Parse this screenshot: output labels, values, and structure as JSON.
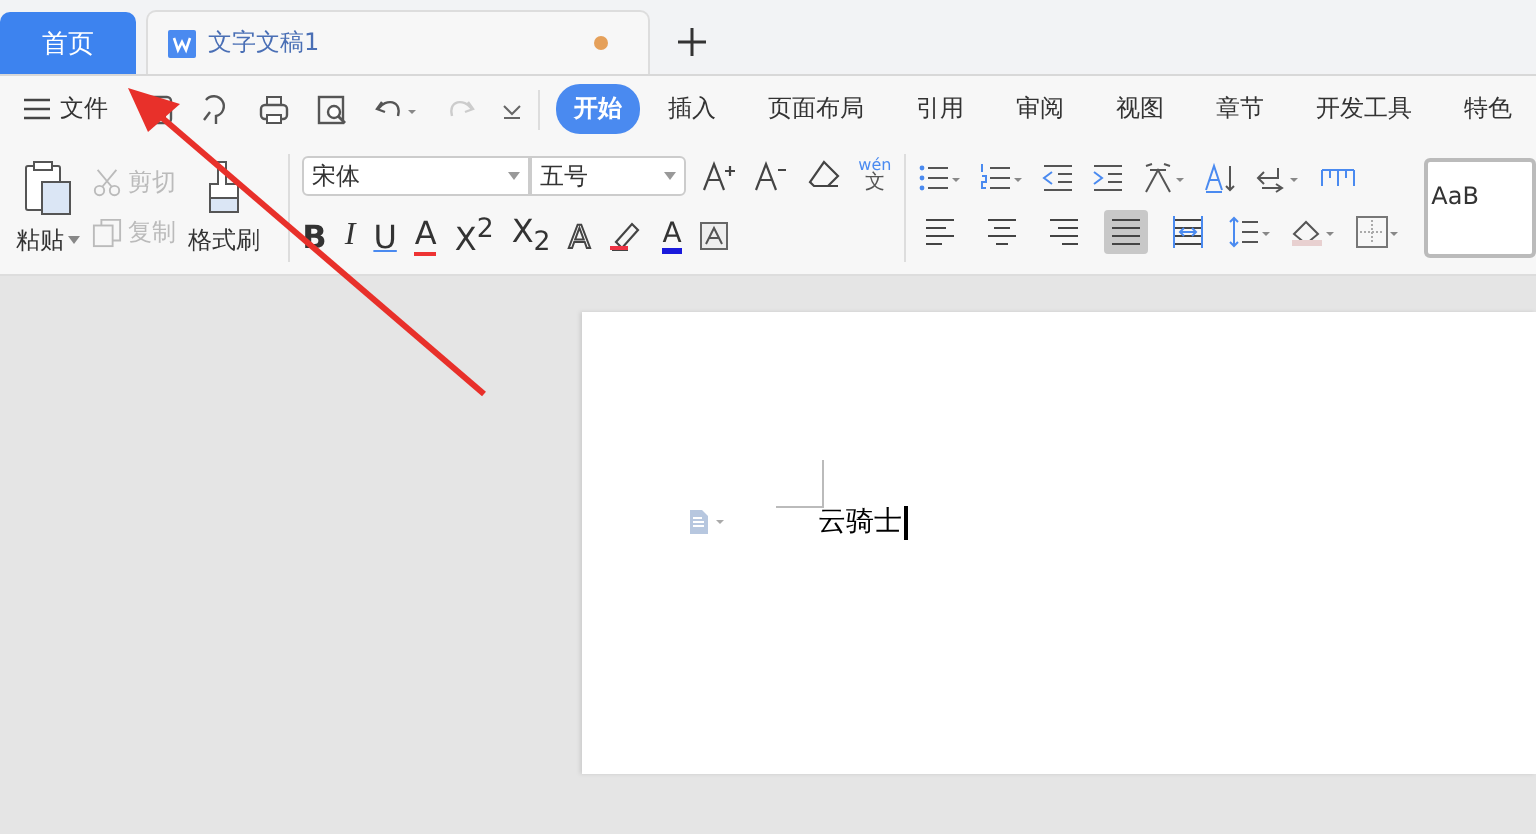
{
  "tabs": [
    {
      "kind": "home",
      "label": "首页",
      "selected": false
    },
    {
      "kind": "document",
      "label": "文字文稿1",
      "selected": true,
      "unsaved": true
    }
  ],
  "file_menu": "文件",
  "ribbon_tabs": [
    {
      "label": "开始",
      "selected": true
    },
    {
      "label": "插入",
      "selected": false
    },
    {
      "label": "页面布局",
      "selected": false
    },
    {
      "label": "引用",
      "selected": false
    },
    {
      "label": "审阅",
      "selected": false
    },
    {
      "label": "视图",
      "selected": false
    },
    {
      "label": "章节",
      "selected": false
    },
    {
      "label": "开发工具",
      "selected": false
    },
    {
      "label": "特色",
      "selected": false
    }
  ],
  "clipboard": {
    "paste": "粘贴",
    "cut": {
      "label": "剪切",
      "disabled": true
    },
    "copy": {
      "label": "复制",
      "disabled": true
    },
    "format_painter": "格式刷"
  },
  "font": {
    "name": "宋体",
    "size": "五号",
    "pinyin": "wén",
    "pinyin_base": "文"
  },
  "format_buttons": [
    {
      "kind": "bold",
      "label": "B"
    },
    {
      "kind": "italic",
      "label": "I"
    },
    {
      "kind": "underline",
      "label": "U"
    },
    {
      "kind": "strike",
      "label": "A"
    },
    {
      "kind": "sup",
      "label": "X$^{2}$"
    },
    {
      "kind": "sub",
      "label": "X$_{2}$"
    },
    {
      "kind": "outline",
      "label": "A"
    }
  ],
  "font_color": "A",
  "alignment": [
    {
      "kind": "left",
      "selected": false
    },
    {
      "kind": "center",
      "selected": false
    },
    {
      "kind": "right",
      "selected": false
    },
    {
      "kind": "justify",
      "selected": true
    },
    {
      "kind": "distributed",
      "selected": false
    }
  ],
  "style_preview": "AaB",
  "document": {
    "text": "云骑士"
  }
}
